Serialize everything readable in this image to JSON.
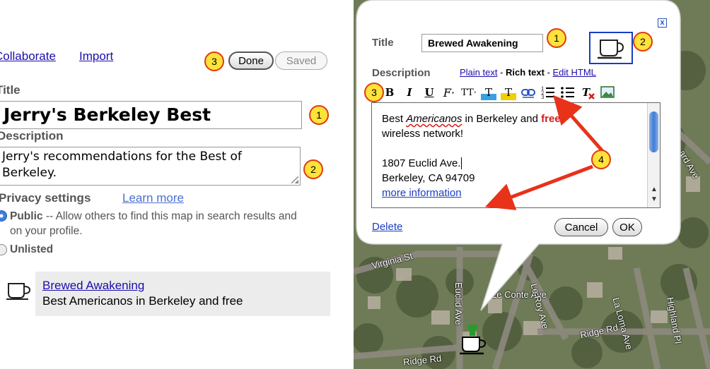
{
  "left": {
    "links": {
      "collaborate": "Collaborate",
      "import": "Import"
    },
    "buttons": {
      "done": "Done",
      "saved": "Saved"
    },
    "callouts": [
      "3",
      "1",
      "2"
    ],
    "title_label": "Title",
    "title_value": "Jerry's Berkeley Best",
    "description_label": "Description",
    "description_value": "Jerry's recommendations for the Best of Berkeley.",
    "privacy_label": "Privacy settings",
    "learn_more": "Learn more",
    "public_label": "Public",
    "public_desc": " -- Allow others to find this map in search results and on your profile.",
    "unlisted_label": "Unlisted",
    "place": {
      "name": "Brewed Awakening",
      "description": "Best Americanos in Berkeley and free"
    }
  },
  "bubble": {
    "title_label": "Title",
    "title_value": "Brewed Awakening",
    "description_label": "Description",
    "modes": {
      "plain": "Plain text",
      "sep1": " - ",
      "rich": "Rich text",
      "sep2": " - ",
      "html": "Edit HTML"
    },
    "close": "x",
    "toolbar": [
      "B",
      "I",
      "U",
      "F·",
      "TT·",
      "T",
      "T",
      "link",
      "ol",
      "ul",
      "clear",
      "image"
    ],
    "editor": {
      "line1_pre": "Best ",
      "line1_em": "Americanos",
      "line1_mid": " in Berkeley and ",
      "line1_red": "free",
      "line2": "wireless network!",
      "addr1": "1807 Euclid Ave.",
      "addr2": "Berkeley, CA 94709",
      "link": "more information"
    },
    "delete": "Delete",
    "cancel": "Cancel",
    "ok": "OK",
    "callouts": [
      "1",
      "2",
      "3",
      "4"
    ]
  },
  "map": {
    "streets": [
      "Virginia St",
      "Euclid Ave",
      "Le Conte Ave",
      "Le Roy Ave",
      "La Loma Ave",
      "Highland Pl",
      "Ridge Rd",
      "Ridge Rd",
      "ard Ave"
    ]
  },
  "colors": {
    "callout_fill": "#ffe23a",
    "callout_stroke": "#e03a12",
    "arrow": "#e8321a",
    "link": "#1a0dab",
    "icon_box": "#1a3cc2"
  }
}
